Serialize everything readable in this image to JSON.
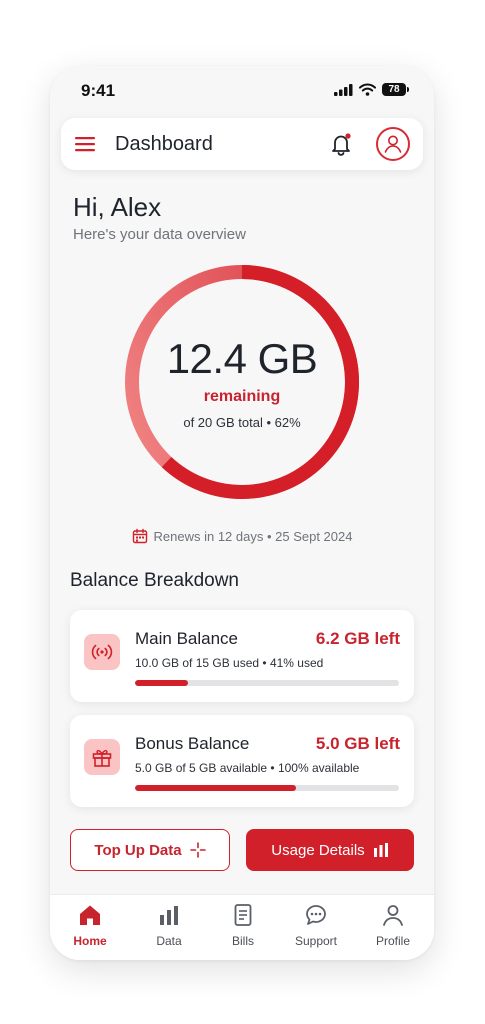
{
  "status_bar": {
    "time": "9:41",
    "battery": "78"
  },
  "header": {
    "title": "Dashboard"
  },
  "greeting": {
    "title": "Hi, Alex",
    "subtitle": "Here's your data overview"
  },
  "usage": {
    "value": "12.4 GB",
    "label": "remaining",
    "detail": "of 20 GB total • 62%",
    "remaining_fraction": 0.62
  },
  "renewal": {
    "text": "Renews in 12 days • 25 Sept 2024"
  },
  "breakdown": {
    "title": "Balance Breakdown",
    "cards": [
      {
        "name": "Main Balance",
        "left": "6.2 GB left",
        "detail": "10.0 GB of 15 GB used • 41% used",
        "bar_fraction": 0.2,
        "icon": "signal-waves-icon"
      },
      {
        "name": "Bonus Balance",
        "left": "5.0 GB left",
        "detail": "5.0 GB of 5 GB available • 100% available",
        "bar_fraction": 0.61,
        "icon": "gift-icon"
      }
    ]
  },
  "actions": {
    "top_up": "Top Up Data",
    "usage_details": "Usage Details"
  },
  "tabs": [
    {
      "label": "Home",
      "icon": "home-icon",
      "active": true
    },
    {
      "label": "Data",
      "icon": "bar-chart-icon",
      "active": false
    },
    {
      "label": "Bills",
      "icon": "document-icon",
      "active": false
    },
    {
      "label": "Support",
      "icon": "chat-support-icon",
      "active": false
    },
    {
      "label": "Profile",
      "icon": "person-icon",
      "active": false
    }
  ],
  "colors": {
    "accent": "#d1202a",
    "accent_light": "#fbc4c4",
    "ring_start": "#d41e28",
    "ring_end": "#ee6a6a"
  }
}
